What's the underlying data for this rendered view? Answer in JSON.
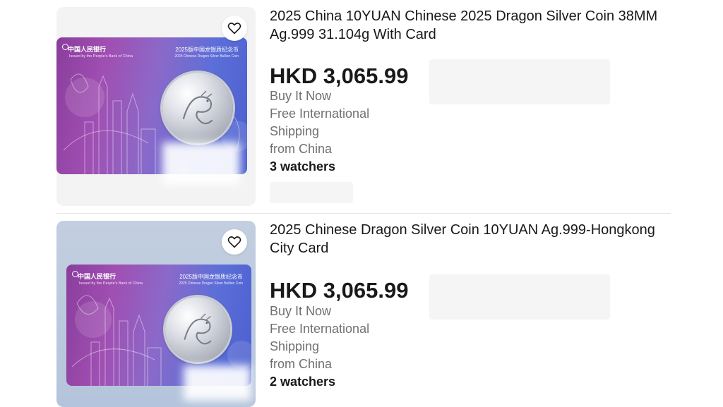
{
  "listings": [
    {
      "title": "2025 China 10YUAN Chinese 2025 Dragon Silver Coin 38MM Ag.999 31.104g With Card",
      "price": "HKD 3,065.99",
      "buy_format": "Buy It Now",
      "shipping_line1": "Free International",
      "shipping_line2": "Shipping",
      "location": "from China",
      "watchers": "3 watchers",
      "card": {
        "header_cn": "中国人民银行",
        "header_en": "Issued by the People's Bank of China",
        "title_cn": "2025版中国龙银质纪念币",
        "title_en": "2025 Chinese Dragon Silver Bullion Coin"
      }
    },
    {
      "title": "2025 Chinese Dragon Silver Coin 10YUAN Ag.999-Hongkong City Card",
      "price": "HKD 3,065.99",
      "buy_format": "Buy It Now",
      "shipping_line1": "Free International",
      "shipping_line2": "Shipping",
      "location": "from China",
      "watchers": "2 watchers",
      "card": {
        "header_cn": "中国人民银行",
        "header_en": "Issued by the People's Bank of China",
        "title_cn": "2025版中国龙银质纪念币",
        "title_en": "2025 Chinese Dragon Silver Bullion Coin"
      }
    }
  ],
  "icons": {
    "favorite": "heart-outline-icon"
  },
  "colors": {
    "text_primary": "#191919",
    "text_secondary": "#707070",
    "divider": "#e5e5e5"
  }
}
